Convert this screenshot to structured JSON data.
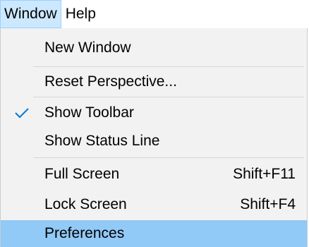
{
  "menubar": {
    "items": [
      {
        "label": "Window",
        "active": true
      },
      {
        "label": "Help",
        "active": false
      }
    ]
  },
  "menu": {
    "items": [
      {
        "label": "New Window",
        "shortcut": ""
      },
      {
        "label": "Reset Perspective...",
        "shortcut": ""
      },
      {
        "label": "Show Toolbar",
        "shortcut": "",
        "checked": true
      },
      {
        "label": "Show Status Line",
        "shortcut": ""
      },
      {
        "label": "Full Screen",
        "shortcut": "Shift+F11"
      },
      {
        "label": "Lock Screen",
        "shortcut": "Shift+F4"
      },
      {
        "label": "Preferences",
        "shortcut": "",
        "highlighted": true
      }
    ]
  },
  "colors": {
    "active_menubar_bg": "#cce8ff",
    "highlight_bg": "#91c9f7",
    "check_color": "#0078d7",
    "menu_bg": "#f2f2f2"
  },
  "icons": {
    "checkmark": "check-icon"
  }
}
